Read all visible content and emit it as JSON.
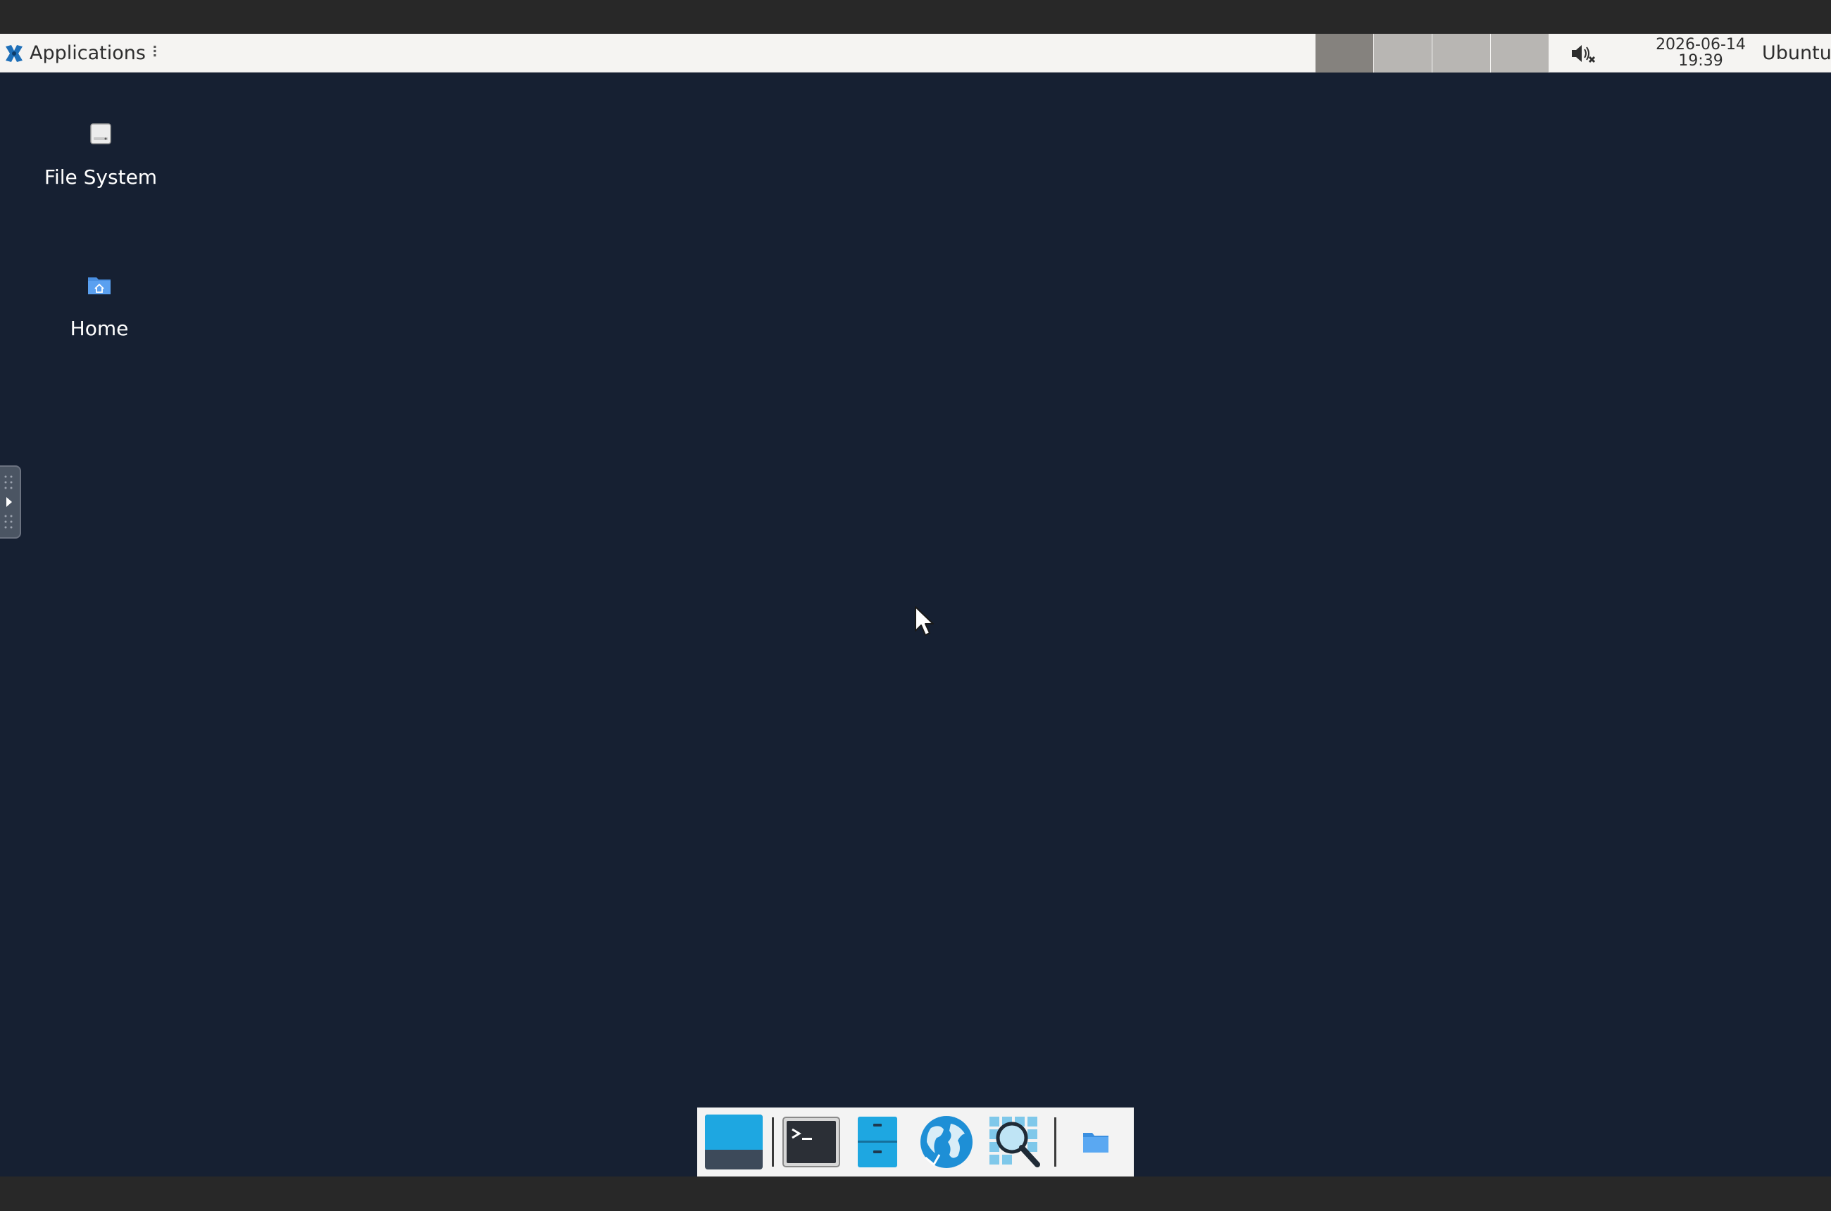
{
  "panel": {
    "applications_label": "Applications",
    "menu_handle": "⠇",
    "workspaces": [
      {
        "id": 1,
        "active": true
      },
      {
        "id": 2,
        "active": false
      },
      {
        "id": 3,
        "active": false
      },
      {
        "id": 4,
        "active": false
      }
    ],
    "volume_icon": "volume-muted-icon",
    "clock": {
      "date": "2026-06-14",
      "time": "19:39"
    },
    "user": "Ubuntu"
  },
  "desktop": {
    "background_color": "#162032",
    "icons": [
      {
        "label": "File System",
        "icon": "drive-icon"
      },
      {
        "label": "Home",
        "icon": "home-folder-icon"
      }
    ]
  },
  "dock": {
    "items": [
      {
        "name": "show-desktop",
        "icon": "desktop-icon"
      },
      {
        "name": "terminal",
        "icon": "terminal-icon"
      },
      {
        "name": "file-manager",
        "icon": "file-cabinet-icon"
      },
      {
        "name": "web-browser",
        "icon": "globe-icon"
      },
      {
        "name": "app-finder",
        "icon": "magnifier-icon"
      },
      {
        "name": "files",
        "icon": "folder-icon"
      }
    ]
  }
}
